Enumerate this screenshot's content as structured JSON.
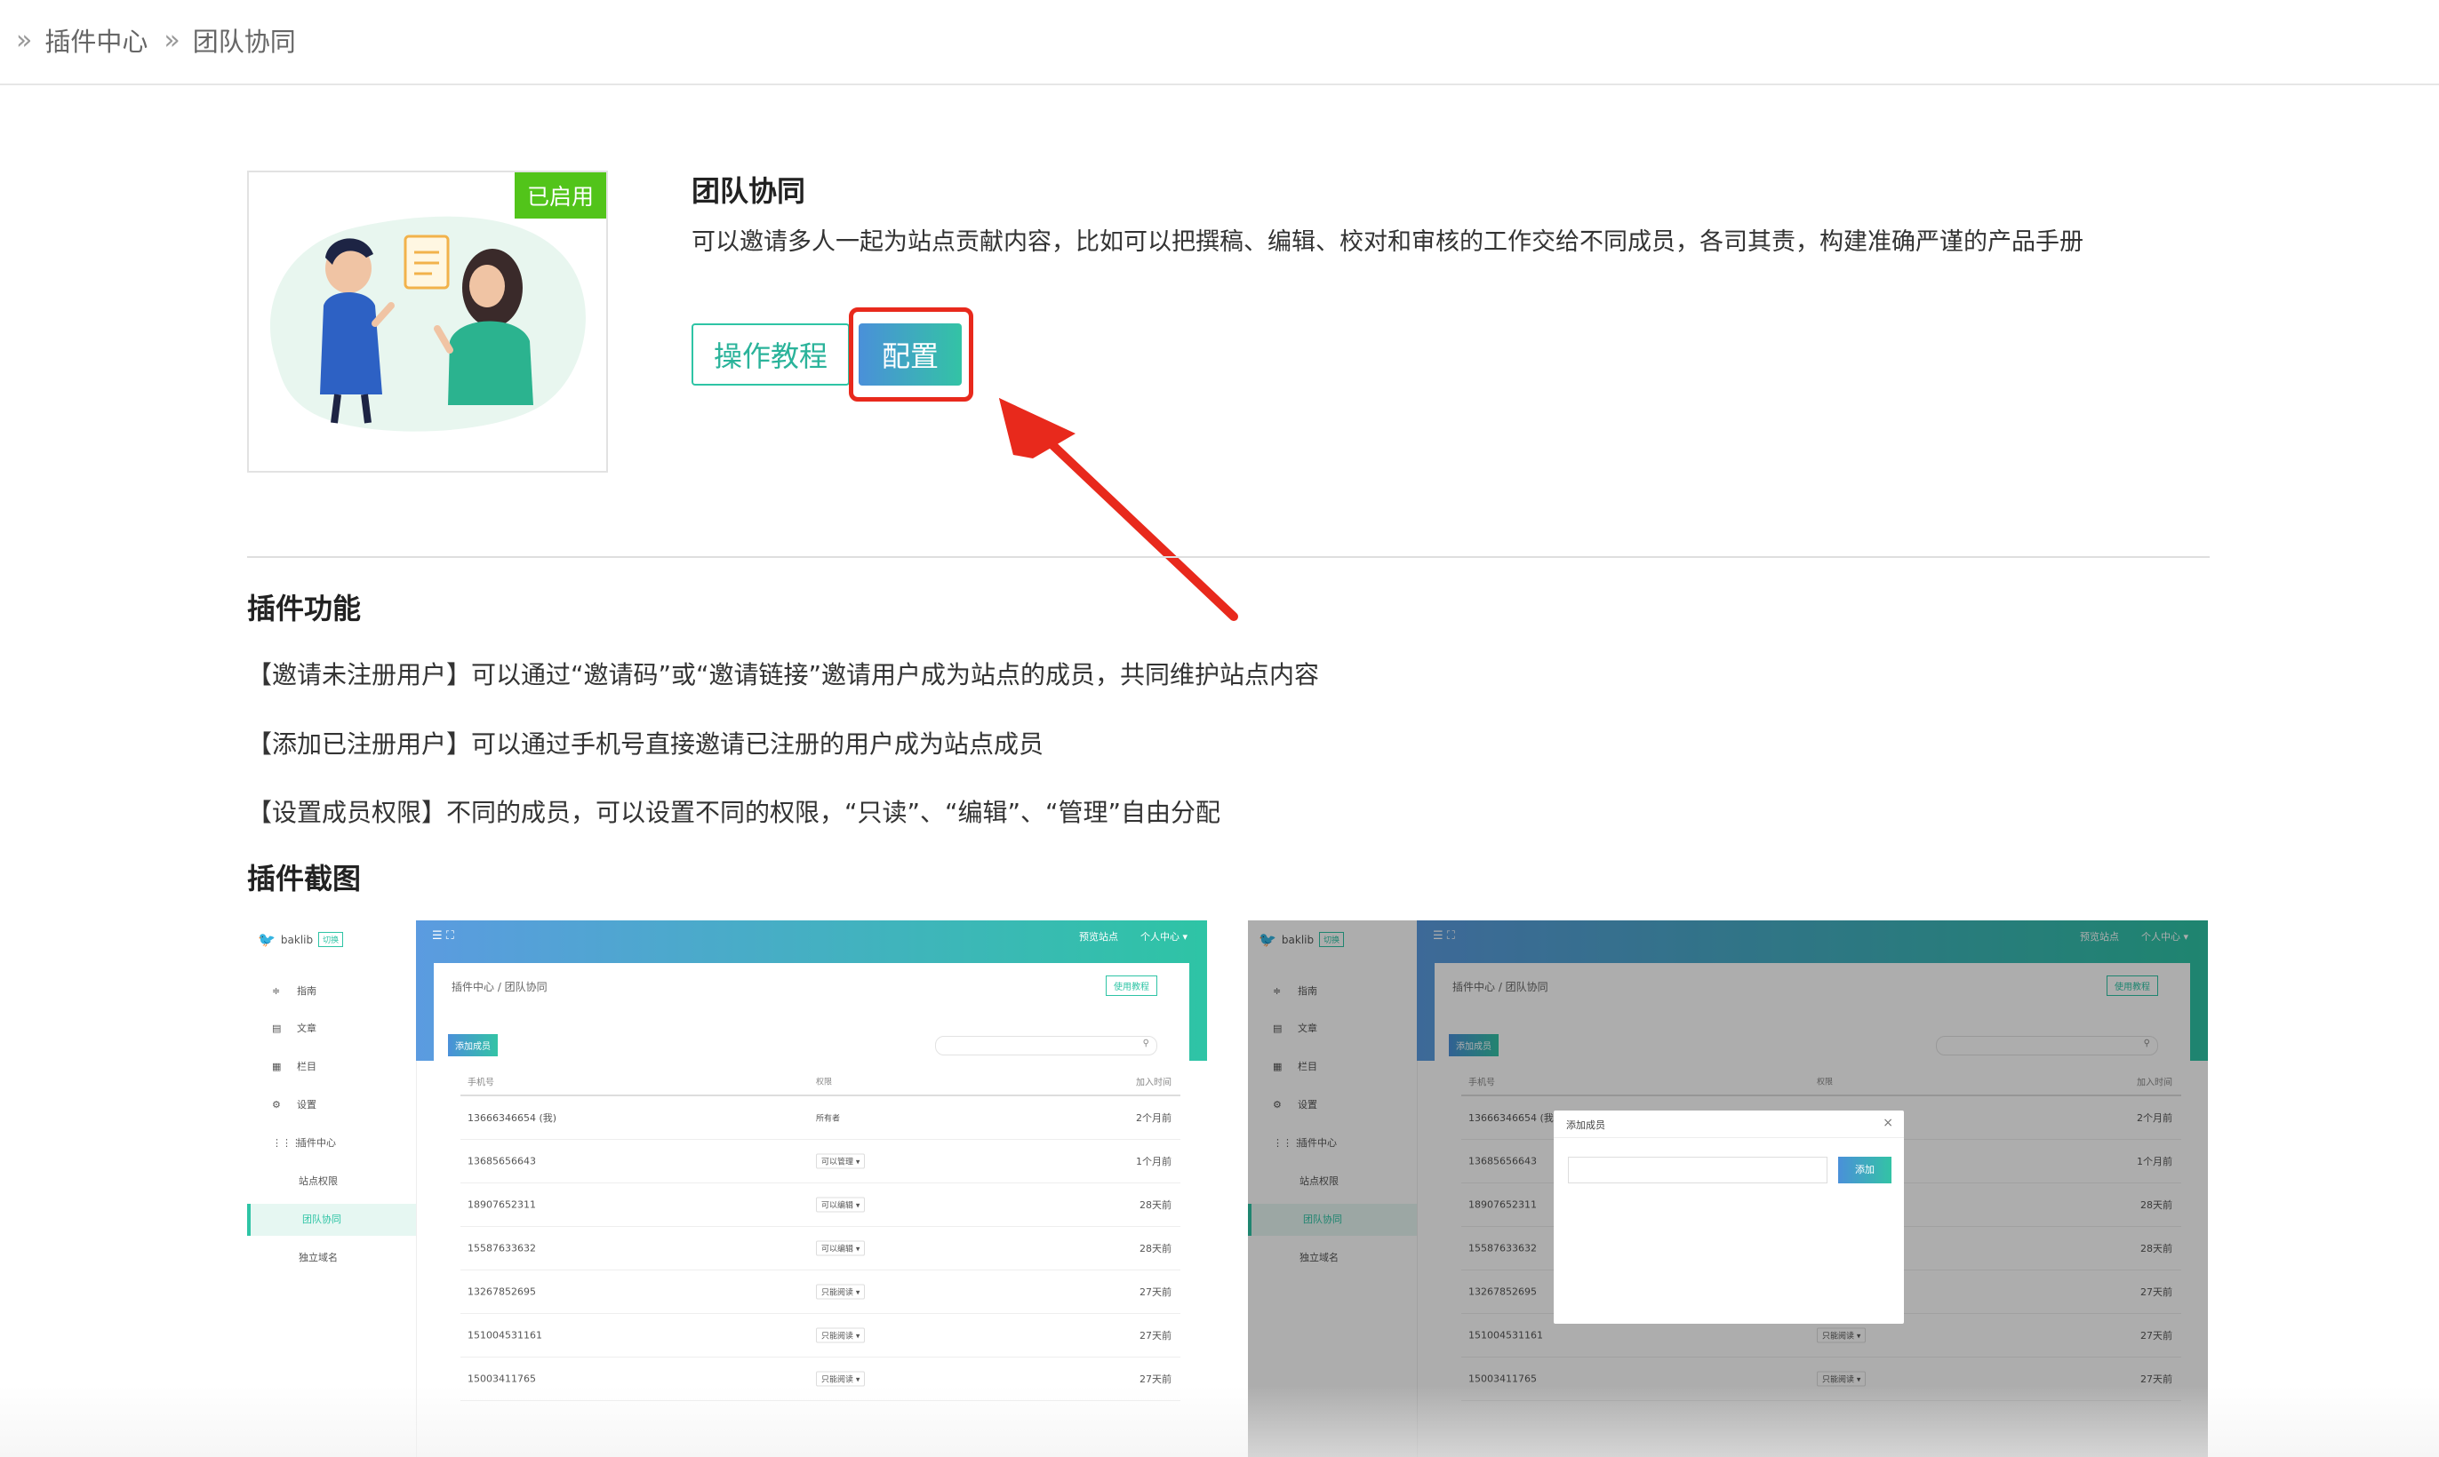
{
  "breadcrumb": {
    "sep": "»",
    "items": [
      "插件中心",
      "团队协同"
    ]
  },
  "plugin": {
    "badge": "已启用",
    "title": "团队协同",
    "description": "可以邀请多人一起为站点贡献内容，比如可以把撰稿、编辑、校对和审核的工作交给不同成员，各司其责，构建准确严谨的产品手册",
    "tutorial_label": "操作教程",
    "config_label": "配置"
  },
  "features": {
    "heading": "插件功能",
    "items": [
      "【邀请未注册用户】可以通过“邀请码”或“邀请链接”邀请用户成为站点的成员，共同维护站点内容",
      "【添加已注册用户】可以通过手机号直接邀请已注册的用户成为站点成员",
      "【设置成员权限】不同的成员，可以设置不同的权限，“只读”、“编辑”、“管理”自由分配"
    ]
  },
  "screenshots_heading": "插件截图",
  "shot": {
    "brand": "baklib",
    "brand_tag": "切换",
    "menu": [
      {
        "icon": "≑",
        "label": "指南"
      },
      {
        "icon": "▤",
        "label": "文章"
      },
      {
        "icon": "▦",
        "label": "栏目"
      },
      {
        "icon": "⚙",
        "label": "设置"
      },
      {
        "icon": "⋮⋮⋮",
        "label": "插件中心"
      }
    ],
    "submenu": [
      "站点权限",
      "团队协同",
      "独立域名"
    ],
    "header_left": "☰  ⛶",
    "preview": "预览站点",
    "user": "个人中心 ▾",
    "breadcrumb": "插件中心 / 团队协同",
    "use_tutorial": "使用教程",
    "add_member": "添加成员",
    "search_icon": "⚲",
    "columns": [
      "手机号",
      "权限",
      "加入时间"
    ],
    "rows": [
      {
        "phone": "13666346654 (我)",
        "role": "所有者",
        "time": "2个月前"
      },
      {
        "phone": "13685656643",
        "role": "可以管理 ▾",
        "time": "1个月前"
      },
      {
        "phone": "18907652311",
        "role": "可以编辑 ▾",
        "time": "28天前"
      },
      {
        "phone": "15587633632",
        "role": "可以编辑 ▾",
        "time": "28天前"
      },
      {
        "phone": "13267852695",
        "role": "只能阅读 ▾",
        "time": "27天前"
      },
      {
        "phone": "151004531161",
        "role": "只能阅读 ▾",
        "time": "27天前"
      },
      {
        "phone": "15003411765",
        "role": "只能阅读 ▾",
        "time": "27天前"
      }
    ],
    "modal_title": "添加成员",
    "modal_close": "×",
    "modal_add": "添加"
  },
  "colors": {
    "accent": "#2ec4a5",
    "blue": "#4a90d9",
    "badge": "#52c41a",
    "highlight": "#e8291c"
  }
}
